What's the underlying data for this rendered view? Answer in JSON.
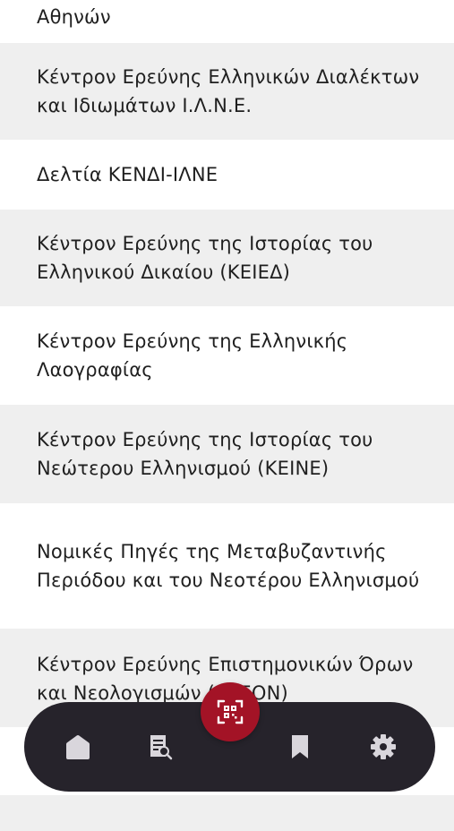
{
  "list": {
    "items": [
      {
        "label": "Αθηνών"
      },
      {
        "label": "Κέντρον Ερεύνης Ελληνικών Διαλέκτων και Ιδιωμάτων Ι.Λ.Ν.Ε."
      },
      {
        "label": "Δελτία ΚΕΝΔΙ-ΙΛΝΕ"
      },
      {
        "label": "Κέντρον Ερεύνης της Ιστορίας του Ελληνικού Δικαίου (ΚΕΙΕΔ)"
      },
      {
        "label": "Κέντρον Ερεύνης της Ελληνικής Λαογραφίας"
      },
      {
        "label": "Κέντρον Ερεύνης της Ιστορίας του Νεώτερου Ελληνισμού (ΚΕΙΝΕ)"
      },
      {
        "label": "Νομικές Πηγές της Μεταβυζαντινής Περιόδου και του Νεοτέρου Ελληνισμού"
      },
      {
        "label": "Κέντρον Ερεύνης Επιστημονικών Όρων και Νεολογισμών (ΚΕΕΟΝ)"
      }
    ]
  },
  "bottom_nav": {
    "items": [
      {
        "icon": "home-icon"
      },
      {
        "icon": "search-document-icon"
      },
      {
        "icon": "bookmark-icon"
      },
      {
        "icon": "settings-icon"
      }
    ],
    "fab_icon": "qr-scan-icon"
  },
  "colors": {
    "row_gray": "#efefef",
    "nav_bg": "#26232b",
    "fab_bg": "#a31326",
    "icon": "#d9d6dc"
  }
}
